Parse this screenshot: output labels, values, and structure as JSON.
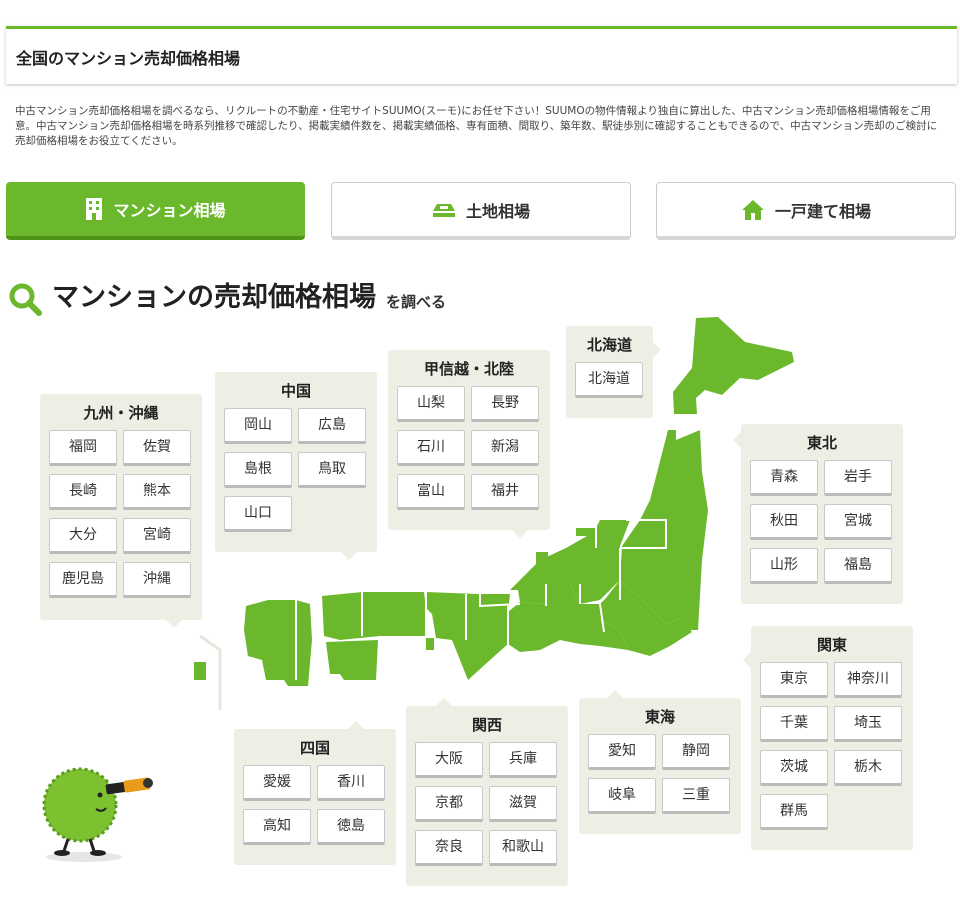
{
  "header": {
    "title": "全国のマンション売却価格相場"
  },
  "description": "中古マンション売却価格相場を調べるなら、リクルートの不動産・住宅サイトSUUMO(スーモ)にお任せ下さい！SUUMOの物件情報より独自に算出した、中古マンション売却価格相場情報をご用意。中古マンション売却価格相場を時系列推移で確認したり、掲載実績件数を、掲載実績価格、専有面積、間取り、築年数、駅徒歩別に確認することもできるので、中古マンション売却のご検討に売却価格相場をお役立てください。",
  "tabs": [
    {
      "label": "マンション相場",
      "icon": "building-icon",
      "active": true
    },
    {
      "label": "土地相場",
      "icon": "land-icon",
      "active": false
    },
    {
      "label": "一戸建て相場",
      "icon": "house-icon",
      "active": false
    }
  ],
  "section": {
    "title": "マンションの売却価格相場",
    "subtitle": "を調べる",
    "icon": "search-icon"
  },
  "colors": {
    "accent": "#6cb82c",
    "map_green": "#6cb82c",
    "panel_bg": "#ecf0e4"
  },
  "regions": {
    "hokkaido": {
      "title": "北海道",
      "prefs": [
        "北海道"
      ]
    },
    "tohoku": {
      "title": "東北",
      "prefs": [
        "青森",
        "岩手",
        "秋田",
        "宮城",
        "山形",
        "福島"
      ]
    },
    "koshinetsu": {
      "title": "甲信越・北陸",
      "prefs": [
        "山梨",
        "長野",
        "石川",
        "新潟",
        "富山",
        "福井"
      ]
    },
    "chugoku": {
      "title": "中国",
      "prefs": [
        "岡山",
        "広島",
        "島根",
        "鳥取",
        "山口"
      ]
    },
    "kyushu": {
      "title": "九州・沖縄",
      "prefs": [
        "福岡",
        "佐賀",
        "長崎",
        "熊本",
        "大分",
        "宮崎",
        "鹿児島",
        "沖縄"
      ]
    },
    "kanto": {
      "title": "関東",
      "prefs": [
        "東京",
        "神奈川",
        "千葉",
        "埼玉",
        "茨城",
        "栃木",
        "群馬"
      ]
    },
    "shikoku": {
      "title": "四国",
      "prefs": [
        "愛媛",
        "香川",
        "高知",
        "徳島"
      ]
    },
    "kansai": {
      "title": "関西",
      "prefs": [
        "大阪",
        "兵庫",
        "京都",
        "滋賀",
        "奈良",
        "和歌山"
      ]
    },
    "tokai": {
      "title": "東海",
      "prefs": [
        "愛知",
        "静岡",
        "岐阜",
        "三重"
      ]
    }
  }
}
